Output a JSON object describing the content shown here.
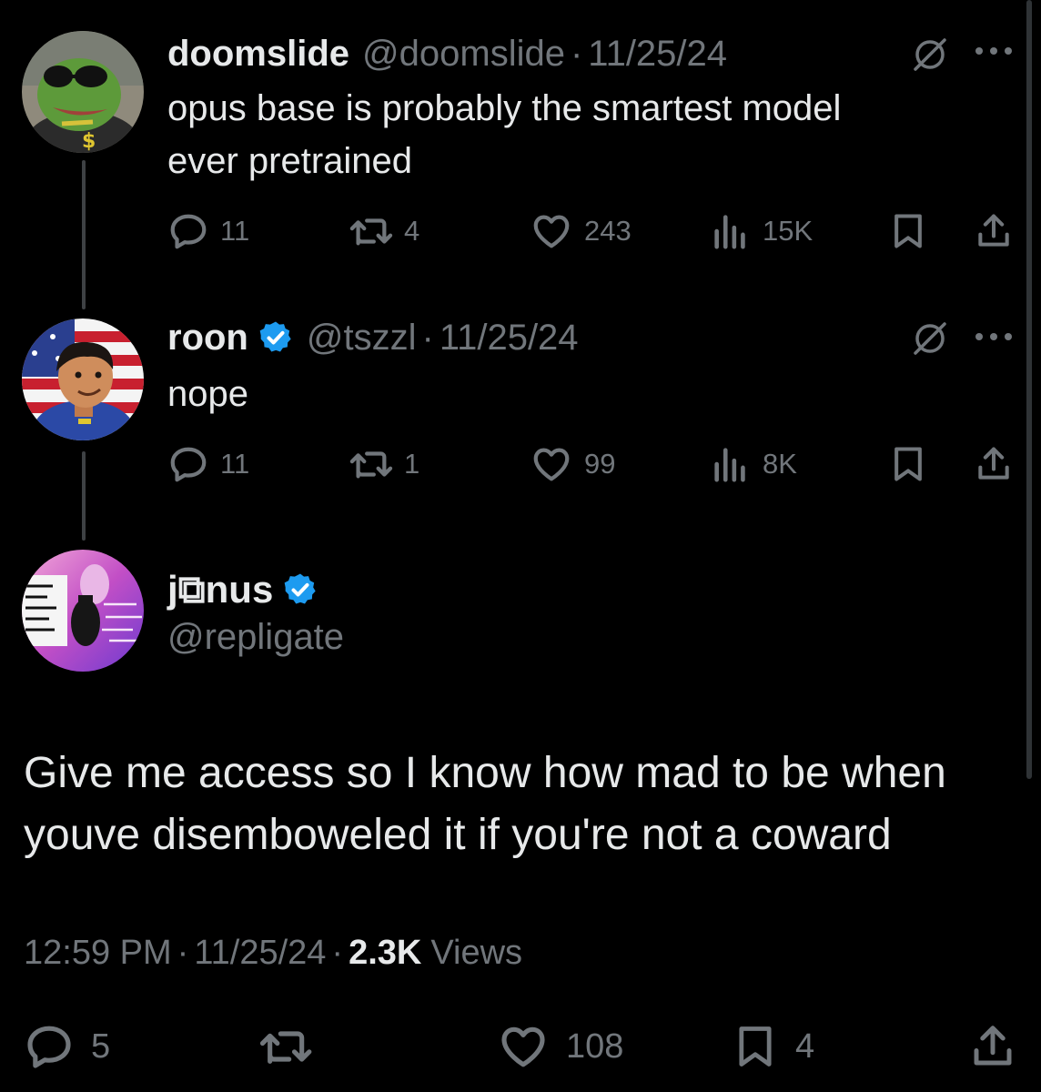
{
  "tweets": [
    {
      "name": "doomslide",
      "handle": "@doomslide",
      "date": "11/25/24",
      "verified": false,
      "text_lines": [
        "opus base is probably the smartest model",
        "ever pretrained"
      ],
      "replies": "11",
      "reposts": "4",
      "likes": "243",
      "views": "15K"
    },
    {
      "name": "roon",
      "handle": "@tszzl",
      "date": "11/25/24",
      "verified": true,
      "text_lines": [
        "nope"
      ],
      "replies": "11",
      "reposts": "1",
      "likes": "99",
      "views": "8K"
    }
  ],
  "focus": {
    "name": "j⧉nus",
    "handle": "@repligate",
    "verified": true,
    "text_lines": [
      "Give me access so I know how mad to be when",
      "youve disemboweled it if you're not a coward"
    ],
    "time": "12:59 PM",
    "date": "11/25/24",
    "views_count": "2.3K",
    "views_label": "Views",
    "replies": "5",
    "likes": "108",
    "bookmarks": "4"
  },
  "separator": "·",
  "colors": {
    "background": "#000000",
    "text": "#e7e9ea",
    "secondary": "#71767b",
    "verified": "#1d9bf0"
  },
  "icons": [
    "reply-icon",
    "repost-icon",
    "like-icon",
    "views-icon",
    "bookmark-icon",
    "share-icon",
    "grok-icon",
    "more-icon",
    "verified-icon"
  ]
}
